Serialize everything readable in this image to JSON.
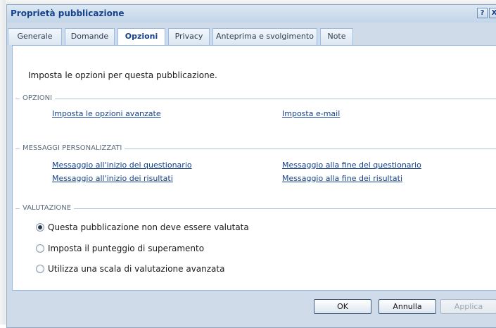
{
  "dialog": {
    "title": "Proprietà pubblicazione",
    "help_icon": "?",
    "close_icon": "X"
  },
  "tabs": [
    {
      "label": "Generale",
      "active": false
    },
    {
      "label": "Domande",
      "active": false
    },
    {
      "label": "Opzioni",
      "active": true
    },
    {
      "label": "Privacy",
      "active": false
    },
    {
      "label": "Anteprima e svolgimento",
      "active": false
    },
    {
      "label": "Note",
      "active": false
    }
  ],
  "panel": {
    "intro": "Imposta le opzioni per questa pubblicazione.",
    "opzioni": {
      "header": "OPZIONI",
      "advanced_link": "Imposta le opzioni avanzate",
      "email_link": "Imposta e-mail"
    },
    "messaggi": {
      "header": "MESSAGGI PERSONALIZZATI",
      "start_questionnaire": "Messaggio all'inizio del questionario",
      "end_questionnaire": "Messaggio alla fine del questionario",
      "start_results": "Messaggio all'inizio dei risultati",
      "end_results": "Messaggio alla fine dei risultati"
    },
    "valutazione": {
      "header": "VALUTAZIONE",
      "options": [
        {
          "label": "Questa pubblicazione non deve essere valutata",
          "selected": true
        },
        {
          "label": "Imposta il punteggio di superamento",
          "selected": false
        },
        {
          "label": "Utilizza una scala di valutazione avanzata",
          "selected": false
        }
      ]
    }
  },
  "footer": {
    "ok": "OK",
    "cancel": "Annulla",
    "apply": "Applica",
    "apply_enabled": false
  },
  "colors": {
    "accent": "#15428b",
    "frame": "#cfdbe8",
    "border": "#99bbe8"
  }
}
